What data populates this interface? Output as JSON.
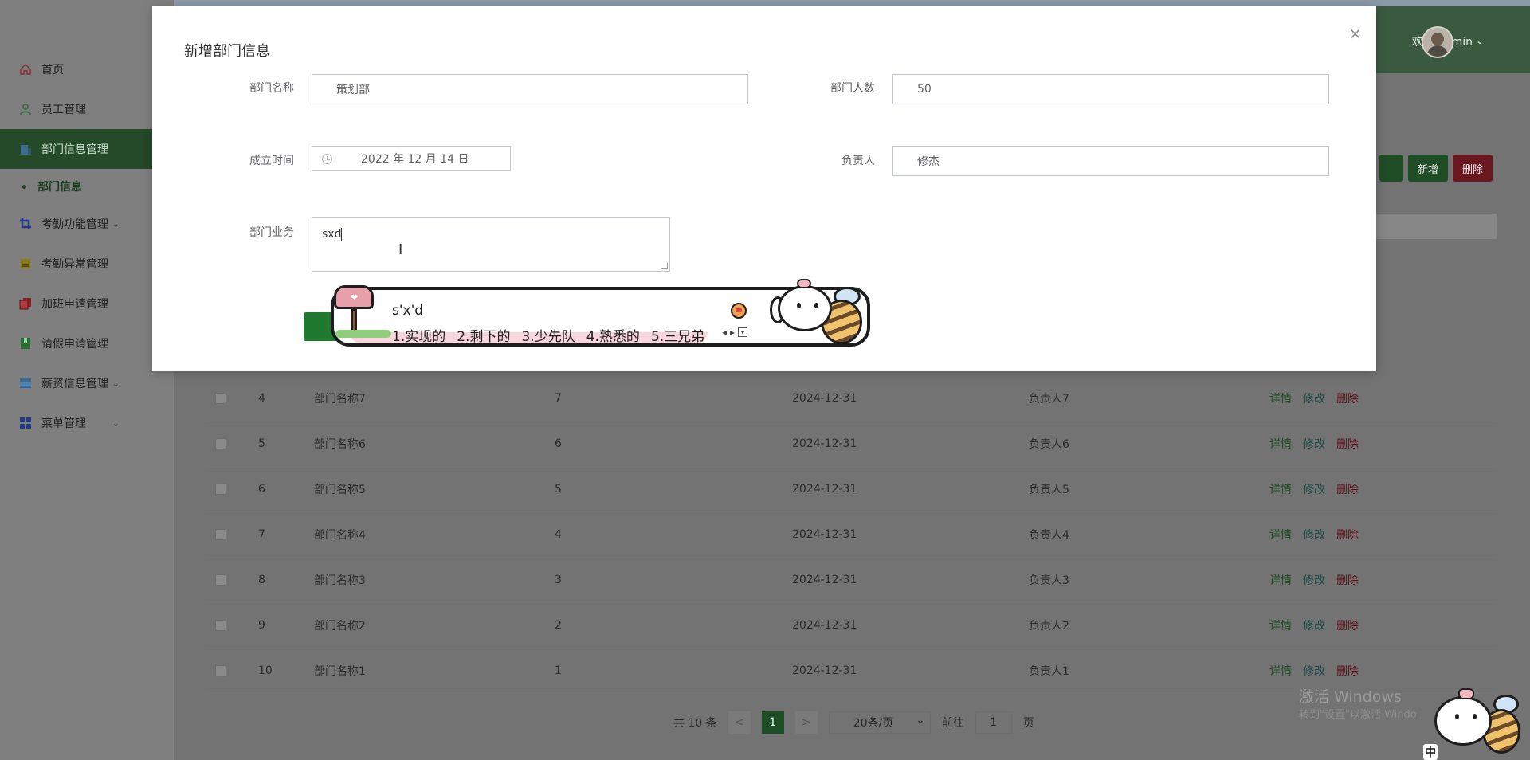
{
  "header": {
    "welcome": "欢迎 admin"
  },
  "sidebar": {
    "items": [
      {
        "label": "首页",
        "icon": "home-icon",
        "color": "#8b2a2a"
      },
      {
        "label": "员工管理",
        "icon": "user-icon",
        "color": "#2f6b36"
      },
      {
        "label": "部门信息管理",
        "icon": "building-icon",
        "color": "#3c6f8f",
        "active": true
      },
      {
        "label": "考勤功能管理",
        "icon": "crop-icon",
        "color": "#1f3c87"
      },
      {
        "label": "考勤异常管理",
        "icon": "folder-icon",
        "color": "#8c7a1e"
      },
      {
        "label": "加班申请管理",
        "icon": "copy-icon",
        "color": "#8b2020"
      },
      {
        "label": "请假申请管理",
        "icon": "bookmark-icon",
        "color": "#2b6b34"
      },
      {
        "label": "薪资信息管理",
        "icon": "layers-icon",
        "color": "#2f6ea5"
      },
      {
        "label": "菜单管理",
        "icon": "grid-icon",
        "color": "#1f3c87"
      }
    ],
    "sub_item": "部门信息"
  },
  "toolbar": {
    "add_label": "新增",
    "delete_label": "删除"
  },
  "table": {
    "rows": [
      {
        "index": "4",
        "name": "部门名称7",
        "count": "7",
        "date": "2024-12-31",
        "leader": "负责人7"
      },
      {
        "index": "5",
        "name": "部门名称6",
        "count": "6",
        "date": "2024-12-31",
        "leader": "负责人6"
      },
      {
        "index": "6",
        "name": "部门名称5",
        "count": "5",
        "date": "2024-12-31",
        "leader": "负责人5"
      },
      {
        "index": "7",
        "name": "部门名称4",
        "count": "4",
        "date": "2024-12-31",
        "leader": "负责人4"
      },
      {
        "index": "8",
        "name": "部门名称3",
        "count": "3",
        "date": "2024-12-31",
        "leader": "负责人3"
      },
      {
        "index": "9",
        "name": "部门名称2",
        "count": "2",
        "date": "2024-12-31",
        "leader": "负责人2"
      },
      {
        "index": "10",
        "name": "部门名称1",
        "count": "1",
        "date": "2024-12-31",
        "leader": "负责人1"
      }
    ],
    "actions": {
      "detail": "详情",
      "edit": "修改",
      "delete": "删除"
    }
  },
  "pagination": {
    "total": "共 10 条",
    "prev": "<",
    "current": "1",
    "next": ">",
    "page_size": "20条/页",
    "goto_label": "前往",
    "goto_value": "1",
    "page_unit": "页"
  },
  "watermark": {
    "line1": "激活 Windows",
    "line2": "转到\"设置\"以激活 Windo"
  },
  "dialog": {
    "title": "新增部门信息",
    "close": "×",
    "fields": {
      "name_label": "部门名称",
      "name_value": "策划部",
      "count_label": "部门人数",
      "count_value": "50",
      "date_label": "成立时间",
      "date_value": "2022 年 12 月 14 日",
      "leader_label": "负责人",
      "leader_value": "修杰",
      "business_label": "部门业务",
      "business_value": "sxd"
    }
  },
  "ime": {
    "code": "s'x'd",
    "candidates": [
      "1.实现的",
      "2.剩下的",
      "3.少先队",
      "4.熟悉的",
      "5.三兄弟"
    ]
  },
  "taskbar": {
    "ime_mode": "中"
  }
}
